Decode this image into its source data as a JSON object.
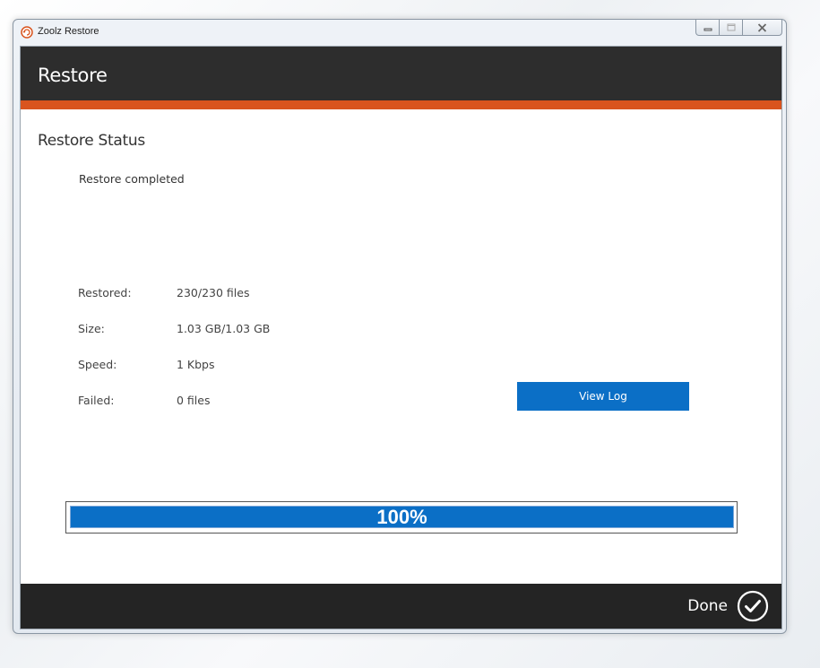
{
  "window": {
    "title": "Zoolz Restore",
    "controls": {
      "minimize_icon": "minimize-icon",
      "maximize_icon": "maximize-icon",
      "close_icon": "close-icon"
    }
  },
  "header": {
    "title": "Restore"
  },
  "main": {
    "section_title": "Restore Status",
    "status_message": "Restore completed",
    "stats": {
      "restored_label": "Restored:",
      "restored_value": "230/230 files",
      "size_label": "Size:",
      "size_value": "1.03 GB/1.03 GB",
      "speed_label": "Speed:",
      "speed_value": "1 Kbps",
      "failed_label": "Failed:",
      "failed_value": "0 files"
    },
    "view_log_label": "View Log",
    "progress": {
      "percent": 100,
      "label": "100%"
    }
  },
  "footer": {
    "done_label": "Done",
    "done_icon": "checkmark-circle-icon"
  },
  "colors": {
    "header_bg": "#2d2d2d",
    "accent": "#d9541e",
    "primary_blue": "#0b6fc6",
    "footer_bg": "#242424"
  }
}
